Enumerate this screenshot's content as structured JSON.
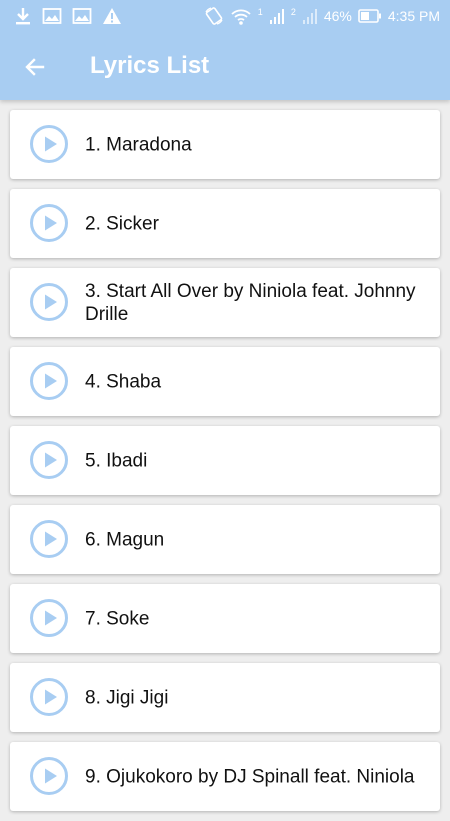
{
  "status_bar": {
    "battery": "46%",
    "time": "4:35 PM",
    "sim1": "1",
    "sim2": "2"
  },
  "toolbar": {
    "title": "Lyrics List"
  },
  "colors": {
    "appbar": "#a8cdf2",
    "play_icon": "#a8cdf2"
  },
  "lyrics": [
    {
      "label": "1. Maradona"
    },
    {
      "label": "2. Sicker"
    },
    {
      "label": "3. Start All Over by Niniola feat. Johnny Drille"
    },
    {
      "label": "4. Shaba"
    },
    {
      "label": "5. Ibadi"
    },
    {
      "label": "6. Magun"
    },
    {
      "label": "7. Soke"
    },
    {
      "label": "8. Jigi Jigi"
    },
    {
      "label": "9. Ojukokoro by DJ Spinall feat. Niniola"
    }
  ]
}
